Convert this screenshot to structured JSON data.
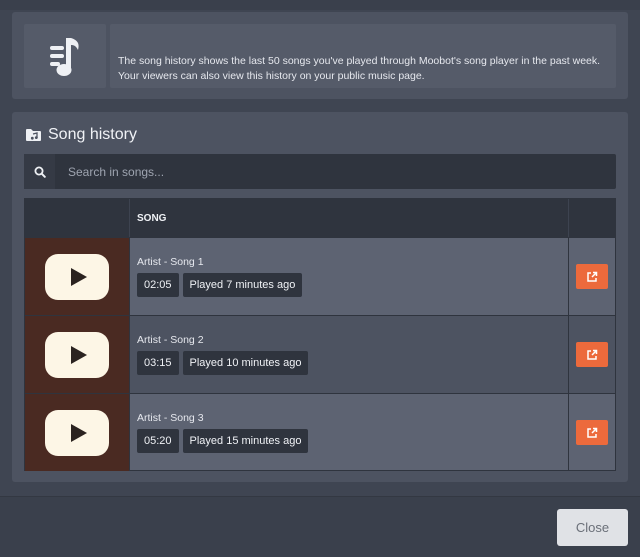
{
  "info": {
    "line1": "The song history shows the last 50 songs you've played through Moobot's song player in the past week.",
    "line2": "Your viewers can also view this history on your public music page.",
    "icon": "music-list-icon"
  },
  "panel": {
    "title": "Song history",
    "title_icon": "music-folder-icon"
  },
  "search": {
    "placeholder": "Search in songs...",
    "value": ""
  },
  "table": {
    "headers": {
      "thumb": "",
      "song": "SONG",
      "actions": ""
    },
    "rows": [
      {
        "name": "Artist - Song 1",
        "duration": "02:05",
        "played": "Played 7 minutes ago"
      },
      {
        "name": "Artist - Song 2",
        "duration": "03:15",
        "played": "Played 10 minutes ago"
      },
      {
        "name": "Artist - Song 3",
        "duration": "05:20",
        "played": "Played 15 minutes ago"
      }
    ]
  },
  "footer": {
    "close_label": "Close"
  },
  "colors": {
    "accent": "#ec6a3c",
    "thumb_bg": "#4a2a22",
    "dark": "#2f343e"
  }
}
